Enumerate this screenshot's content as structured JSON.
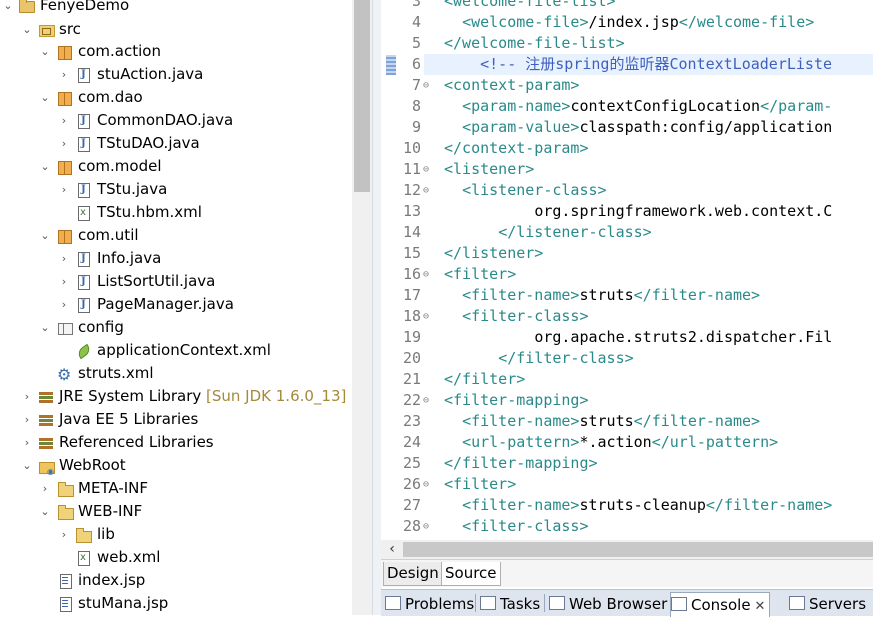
{
  "project_tree": {
    "project": "FenyeDemo",
    "src": "src",
    "packages": [
      {
        "name": "com.action",
        "files": [
          "stuAction.java"
        ]
      },
      {
        "name": "com.dao",
        "files": [
          "CommonDAO.java",
          "TStuDAO.java"
        ]
      },
      {
        "name": "com.model",
        "files": [
          "TStu.java",
          "TStu.hbm.xml"
        ]
      },
      {
        "name": "com.util",
        "files": [
          "Info.java",
          "ListSortUtil.java",
          "PageManager.java"
        ]
      }
    ],
    "config": {
      "name": "config",
      "file": "applicationContext.xml"
    },
    "struts": "struts.xml",
    "jre": {
      "name": "JRE System Library",
      "decoration": "[Sun JDK 1.6.0_13]"
    },
    "javaee": "Java EE 5 Libraries",
    "referenced": "Referenced Libraries",
    "webroot": {
      "name": "WebRoot",
      "meta_inf": "META-INF",
      "web_inf": "WEB-INF",
      "lib": "lib",
      "web_xml": "web.xml",
      "index": "index.jsp",
      "stumana": "stuMana.jsp"
    }
  },
  "editor": {
    "first_line": 3,
    "lines": [
      {
        "n": 3,
        "fold": "",
        "indent": "",
        "segments": [
          [
            "tag",
            "<welcome-file-list>"
          ]
        ]
      },
      {
        "n": 4,
        "fold": "",
        "indent": "  ",
        "segments": [
          [
            "tag",
            "<welcome-file>"
          ],
          [
            "txt",
            "/index.jsp"
          ],
          [
            "tag",
            "</welcome-file>"
          ]
        ]
      },
      {
        "n": 5,
        "fold": "",
        "indent": "",
        "segments": [
          [
            "tag",
            "</welcome-file-list>"
          ]
        ]
      },
      {
        "n": 6,
        "fold": "",
        "indent": "    ",
        "segments": [
          [
            "cmt",
            "<!-- 注册spring的监听器ContextLoaderListe"
          ]
        ]
      },
      {
        "n": 7,
        "fold": "⊖",
        "indent": "",
        "segments": [
          [
            "tag",
            "<context-param>"
          ]
        ]
      },
      {
        "n": 8,
        "fold": "",
        "indent": "  ",
        "segments": [
          [
            "tag",
            "<param-name>"
          ],
          [
            "txt",
            "contextConfigLocation"
          ],
          [
            "tag",
            "</param-"
          ]
        ]
      },
      {
        "n": 9,
        "fold": "",
        "indent": "  ",
        "segments": [
          [
            "tag",
            "<param-value>"
          ],
          [
            "txt",
            "classpath:config/application"
          ]
        ]
      },
      {
        "n": 10,
        "fold": "",
        "indent": "",
        "segments": [
          [
            "tag",
            "</context-param>"
          ]
        ]
      },
      {
        "n": 11,
        "fold": "⊖",
        "indent": "",
        "segments": [
          [
            "tag",
            "<listener>"
          ]
        ]
      },
      {
        "n": 12,
        "fold": "⊖",
        "indent": "  ",
        "segments": [
          [
            "tag",
            "<listener-class>"
          ]
        ]
      },
      {
        "n": 13,
        "fold": "",
        "indent": "          ",
        "segments": [
          [
            "txt",
            "org.springframework.web.context.C"
          ]
        ]
      },
      {
        "n": 14,
        "fold": "",
        "indent": "      ",
        "segments": [
          [
            "tag",
            "</listener-class>"
          ]
        ]
      },
      {
        "n": 15,
        "fold": "",
        "indent": "",
        "segments": [
          [
            "tag",
            "</listener>"
          ]
        ]
      },
      {
        "n": 16,
        "fold": "⊖",
        "indent": "",
        "segments": [
          [
            "tag",
            "<filter>"
          ]
        ]
      },
      {
        "n": 17,
        "fold": "",
        "indent": "  ",
        "segments": [
          [
            "tag",
            "<filter-name>"
          ],
          [
            "txt",
            "struts"
          ],
          [
            "tag",
            "</filter-name>"
          ]
        ]
      },
      {
        "n": 18,
        "fold": "⊖",
        "indent": "  ",
        "segments": [
          [
            "tag",
            "<filter-class>"
          ]
        ]
      },
      {
        "n": 19,
        "fold": "",
        "indent": "          ",
        "segments": [
          [
            "txt",
            "org.apache.struts2.dispatcher.Fil"
          ]
        ]
      },
      {
        "n": 20,
        "fold": "",
        "indent": "      ",
        "segments": [
          [
            "tag",
            "</filter-class>"
          ]
        ]
      },
      {
        "n": 21,
        "fold": "",
        "indent": "",
        "segments": [
          [
            "tag",
            "</filter>"
          ]
        ]
      },
      {
        "n": 22,
        "fold": "⊖",
        "indent": "",
        "segments": [
          [
            "tag",
            "<filter-mapping>"
          ]
        ]
      },
      {
        "n": 23,
        "fold": "",
        "indent": "  ",
        "segments": [
          [
            "tag",
            "<filter-name>"
          ],
          [
            "txt",
            "struts"
          ],
          [
            "tag",
            "</filter-name>"
          ]
        ]
      },
      {
        "n": 24,
        "fold": "",
        "indent": "  ",
        "segments": [
          [
            "tag",
            "<url-pattern>"
          ],
          [
            "txt",
            "*.action"
          ],
          [
            "tag",
            "</url-pattern>"
          ]
        ]
      },
      {
        "n": 25,
        "fold": "",
        "indent": "",
        "segments": [
          [
            "tag",
            "</filter-mapping>"
          ]
        ]
      },
      {
        "n": 26,
        "fold": "⊖",
        "indent": "",
        "segments": [
          [
            "tag",
            "<filter>"
          ]
        ]
      },
      {
        "n": 27,
        "fold": "",
        "indent": "  ",
        "segments": [
          [
            "tag",
            "<filter-name>"
          ],
          [
            "txt",
            "struts-cleanup"
          ],
          [
            "tag",
            "</filter-name>"
          ]
        ]
      },
      {
        "n": 28,
        "fold": "⊖",
        "indent": "  ",
        "segments": [
          [
            "tag",
            "<filter-class>"
          ]
        ]
      }
    ],
    "highlighted_line": 6
  },
  "editor_tabs": {
    "design": "Design",
    "source": "Source",
    "active": "Source"
  },
  "views": {
    "problems": "Problems",
    "tasks": "Tasks",
    "web_browser": "Web Browser",
    "console": "Console",
    "servers": "Servers",
    "close_glyph": "✕"
  },
  "colors": {
    "tag": "#2a8a8a",
    "comment": "#3f5fbf",
    "current_line": "#e8f2fe",
    "text": "#000000"
  }
}
